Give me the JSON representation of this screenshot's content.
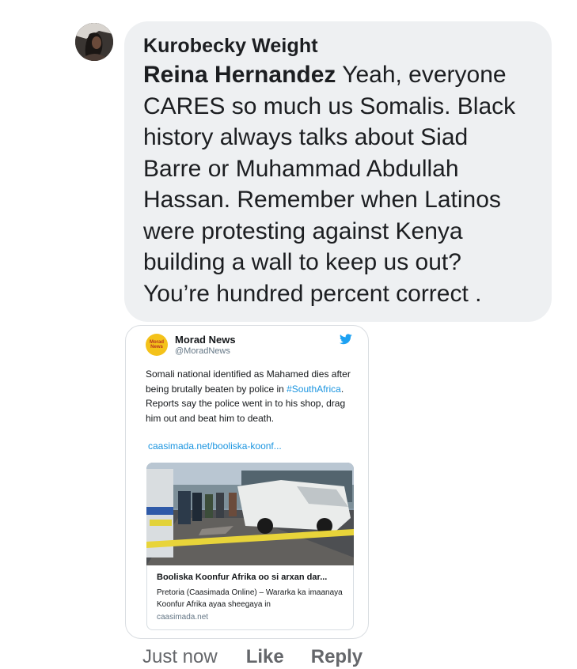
{
  "comment": {
    "author": "Kurobecky Weight",
    "mention": "Reina Hernandez",
    "lines": [
      " Yeah, everyone",
      "CARES so much us Somalis. Black",
      "history always talks about Siad",
      "Barre or Muhammad Abdullah",
      "Hassan. Remember when Latinos",
      "were protesting against Kenya",
      "building a wall to keep us out?",
      "You’re hundred percent correct ."
    ]
  },
  "tweet": {
    "name": "Morad News",
    "handle": "@MoradNews",
    "avatar_text": "Morad News",
    "text_before": "Somali national identified as Mahamed dies after being brutally beaten by police in ",
    "hashtag": "#SouthAfrica",
    "text_after": ". Reports say the police went in to his shop, drag him out and beat him to death.",
    "link": "caasimada.net/booliska-koonf...",
    "card": {
      "title": "Booliska Koonfur Afrika oo si arxan dar...",
      "description": "Pretoria (Caasimada Online) – Wararka ka imaanaya Koonfur Afrika ayaa sheegaya in",
      "domain": "caasimada.net"
    }
  },
  "actions": {
    "timestamp": "Just now",
    "like": "Like",
    "reply": "Reply"
  },
  "colors": {
    "bubble": "#eef0f2",
    "twitter_blue": "#1b95e0",
    "meta_gray": "#65676b"
  }
}
